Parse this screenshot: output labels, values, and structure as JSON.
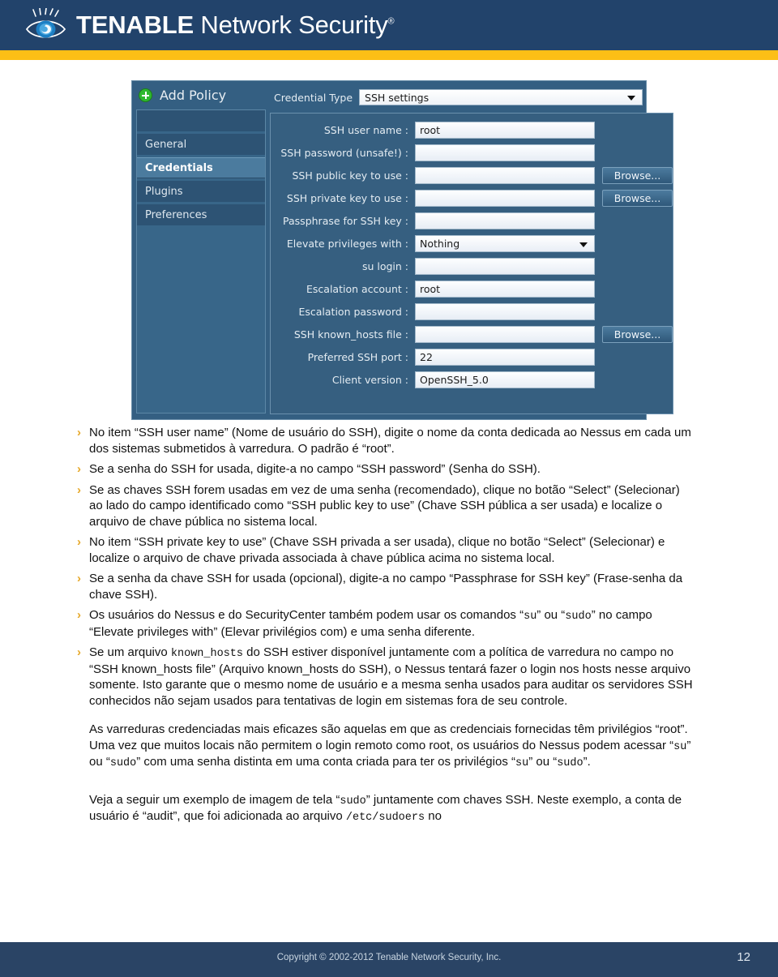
{
  "header": {
    "brand_bold": "TENABLE",
    "brand_light": "Network Security",
    "registered_mark": "®",
    "logo_icon": "eye-logo-icon",
    "navy": "#22436b",
    "gold": "#fcbf16"
  },
  "screenshot": {
    "title": "Add Policy",
    "add_icon": "plus-circle-icon",
    "nav_items": [
      {
        "label": "General",
        "active": false
      },
      {
        "label": "Credentials",
        "active": true
      },
      {
        "label": "Plugins",
        "active": false
      },
      {
        "label": "Preferences",
        "active": false
      }
    ],
    "credential_type": {
      "label": "Credential Type",
      "value": "SSH settings",
      "caret_icon": "chevron-down-icon"
    },
    "fields": [
      {
        "label": "SSH user name :",
        "value": "root",
        "type": "text",
        "browse": false
      },
      {
        "label": "SSH password (unsafe!) :",
        "value": "",
        "type": "text",
        "browse": false
      },
      {
        "label": "SSH public key to use :",
        "value": "",
        "type": "text",
        "browse": true
      },
      {
        "label": "SSH private key to use :",
        "value": "",
        "type": "text",
        "browse": true
      },
      {
        "label": "Passphrase for SSH key :",
        "value": "",
        "type": "text",
        "browse": false
      },
      {
        "label": "Elevate privileges with :",
        "value": "Nothing",
        "type": "select",
        "browse": false
      },
      {
        "label": "su login :",
        "value": "",
        "type": "text",
        "browse": false
      },
      {
        "label": "Escalation account :",
        "value": "root",
        "type": "text",
        "browse": false
      },
      {
        "label": "Escalation password :",
        "value": "",
        "type": "text",
        "browse": false
      },
      {
        "label": "SSH known_hosts file :",
        "value": "",
        "type": "text",
        "browse": true
      },
      {
        "label": "Preferred SSH port :",
        "value": "22",
        "type": "text",
        "browse": false
      },
      {
        "label": "Client version :",
        "value": "OpenSSH_5.0",
        "type": "text",
        "browse": false
      }
    ],
    "browse_label": "Browse..."
  },
  "content": {
    "bullet_marker": "›",
    "bullets": [
      "No item “SSH user name” (Nome de usuário do SSH), digite o nome da conta dedicada ao Nessus em cada um dos sistemas submetidos à varredura. O padrão é “root”.",
      "Se a senha do SSH for usada, digite-a no campo “SSH password” (Senha do SSH).",
      "Se as chaves SSH forem usadas em vez de uma senha (recomendado), clique no botão “Select” (Selecionar) ao lado do campo identificado como “SSH public key to use” (Chave SSH pública a ser usada) e localize o arquivo de chave pública no sistema local.",
      "No item “SSH private key to use” (Chave SSH privada a ser usada), clique no botão “Select” (Selecionar) e localize o arquivo de chave privada associada à chave pública acima no sistema local.",
      "Se a senha da chave SSH for usada (opcional), digite-a no campo “Passphrase for SSH key” (Frase-senha da chave SSH)."
    ],
    "bullet_su_sudo": {
      "p1": "Os usuários do Nessus e do SecurityCenter também podem usar os comandos “",
      "su": "su",
      "p2": "” ou “",
      "sudo": "sudo",
      "p3": "” no campo “Elevate privileges with” (Elevar privilégios com) e uma senha diferente."
    },
    "bullet_known_hosts": {
      "p1": "Se um arquivo ",
      "code": "known_hosts",
      "p2": " do SSH estiver disponível juntamente com a política de varredura no campo no “SSH known_hosts file” (Arquivo known_hosts do SSH), o Nessus tentará fazer o login nos hosts nesse arquivo somente. Isto garante que o mesmo nome de usuário e a mesma senha usados para auditar os servidores SSH conhecidos não sejam usados para tentativas de login em sistemas fora de seu controle."
    },
    "paragraph_root": {
      "p1": "As varreduras credenciadas mais eficazes são aquelas em que as credenciais fornecidas têm privilégios “root”. Uma vez que muitos locais não permitem o login remoto como root, os usuários do Nessus podem acessar “",
      "su1": "su",
      "p2": "” ou “",
      "sudo1": "sudo",
      "p3": "” com uma senha distinta em uma conta criada para ter os privilégios “",
      "su2": "su",
      "p4": "” ou “",
      "sudo2": "sudo",
      "p5": "”."
    },
    "paragraph_example": {
      "p1": "Veja a seguir um exemplo de imagem de tela “",
      "sudo": "sudo",
      "p2": "” juntamente com chaves SSH. Neste exemplo, a conta de usuário é “audit”, que foi adicionada ao arquivo ",
      "path": "/etc/sudoers",
      "p3": " no"
    }
  },
  "footer": {
    "copyright": "Copyright © 2002-2012 Tenable Network Security, Inc.",
    "page_number": "12",
    "background": "#2a4465"
  }
}
